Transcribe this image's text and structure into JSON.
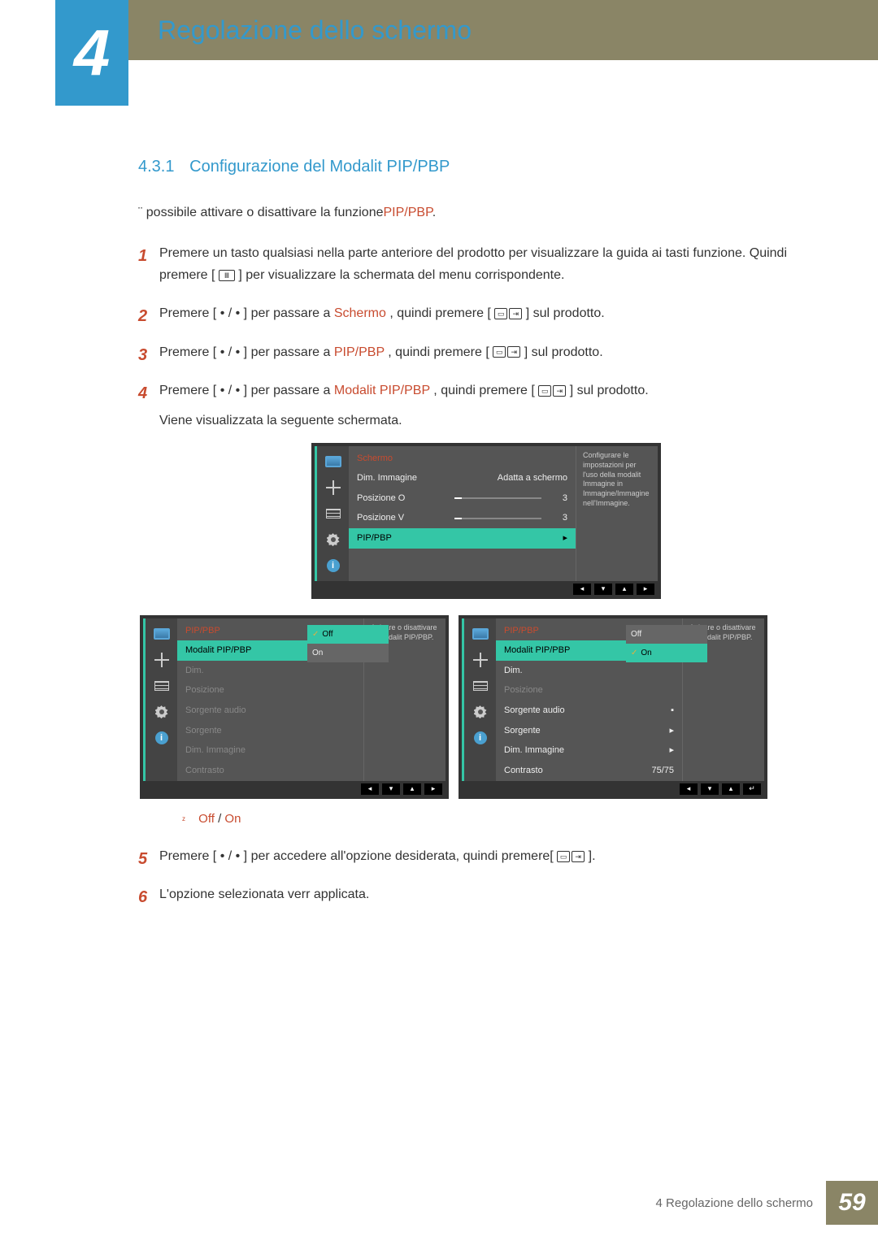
{
  "chapter": {
    "number": "4",
    "title": "Regolazione dello schermo"
  },
  "section": {
    "number": "4.3.1",
    "title": "Configurazione  del Modalit  PIP/PBP"
  },
  "intro": {
    "pre": "¨ possibile attivare o disattivare la funzione",
    "hl": "PIP/PBP",
    "post": "."
  },
  "steps": {
    "s1a": "Premere un tasto qualsiasi nella parte anteriore del prodotto per visualizzare la guida ai tasti funzione. Quindi premere [",
    "s1b": "] per visualizzare la schermata del menu corrispondente.",
    "s2a": "Premere [ • / • ] per passare a",
    "s2hl": "Schermo",
    "s2b": ", quindi premere [",
    "s2c": "] sul prodotto.",
    "s3a": "Premere [ • / • ] per passare a",
    "s3hl": "PIP/PBP",
    "s3b": ", quindi premere [",
    "s3c": "] sul prodotto.",
    "s4a": "Premere [ • / • ] per passare a",
    "s4hl": "Modalit  PIP/PBP",
    "s4b": ", quindi premere [",
    "s4c": "] sul prodotto.",
    "s4d": "Viene visualizzata la seguente schermata.",
    "s5a": "Premere [ • / • ] per accedere all'opzione desiderata, quindi premere[",
    "s5b": "].",
    "s6": "L'opzione selezionata verr  applicata.",
    "n1": "1",
    "n2": "2",
    "n3": "3",
    "n4": "4",
    "n5": "5",
    "n6": "6"
  },
  "bullet": {
    "off": "Off",
    "sep": " / ",
    "on": "On"
  },
  "osd1": {
    "title": "Schermo",
    "rows": {
      "r1": {
        "label": "Dim. Immagine",
        "value": "Adatta a schermo"
      },
      "r2": {
        "label": "Posizione O",
        "value": "3"
      },
      "r3": {
        "label": "Posizione V",
        "value": "3"
      },
      "r4": {
        "label": "PIP/PBP",
        "arrow": "▸"
      }
    },
    "meta": "Configurare le impostazioni per l'uso della modalit Immagine in Immagine/Immagine nell'Immagine.",
    "nav": {
      "b1": "◂",
      "b2": "▾",
      "b3": "▴",
      "b4": "▸"
    }
  },
  "osd2": {
    "title": "PIP/PBP",
    "rows": {
      "modalit": "Modalit  PIP/PBP",
      "dim": "Dim.",
      "posizione": "Posizione",
      "sorgente_audio": "Sorgente audio",
      "sorgente": "Sorgente",
      "dim_img": "Dim. Immagine",
      "contrasto": "Contrasto"
    },
    "options": {
      "off": "Off",
      "on": "On"
    },
    "meta": "Attivare o disattivare la modalit  PIP/PBP.",
    "nav": {
      "b1": "◂",
      "b2": "▾",
      "b3": "▴",
      "b4": "▸",
      "enter": "↵"
    },
    "contrasto_val": "75/75",
    "sq": "▪"
  },
  "footer": {
    "label": "4 Regolazione dello schermo",
    "page": "59"
  }
}
